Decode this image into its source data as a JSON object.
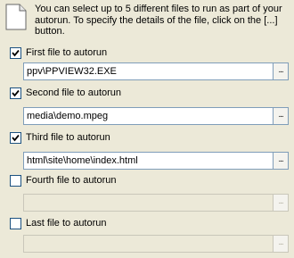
{
  "intro": {
    "text": "You can select up to 5 different files to run as part of your autorun. To specify the details of the file, click on the [...] button.",
    "icon": "document-icon"
  },
  "files": [
    {
      "label": "First file to autorun",
      "checked": true,
      "value": "ppv\\PPVIEW32.EXE",
      "enabled": true
    },
    {
      "label": "Second file to autorun",
      "checked": true,
      "value": "media\\demo.mpeg",
      "enabled": true
    },
    {
      "label": "Third file to autorun",
      "checked": true,
      "value": "html\\site\\home\\index.html",
      "enabled": true
    },
    {
      "label": "Fourth file to autorun",
      "checked": false,
      "value": "",
      "enabled": false
    },
    {
      "label": "Last file to autorun",
      "checked": false,
      "value": "",
      "enabled": false
    }
  ],
  "browse_label": "...",
  "colors": {
    "background": "#ece9d8",
    "input_border": "#7f9db9",
    "checkbox_border": "#1c5180",
    "check_mark": "#21a121"
  }
}
